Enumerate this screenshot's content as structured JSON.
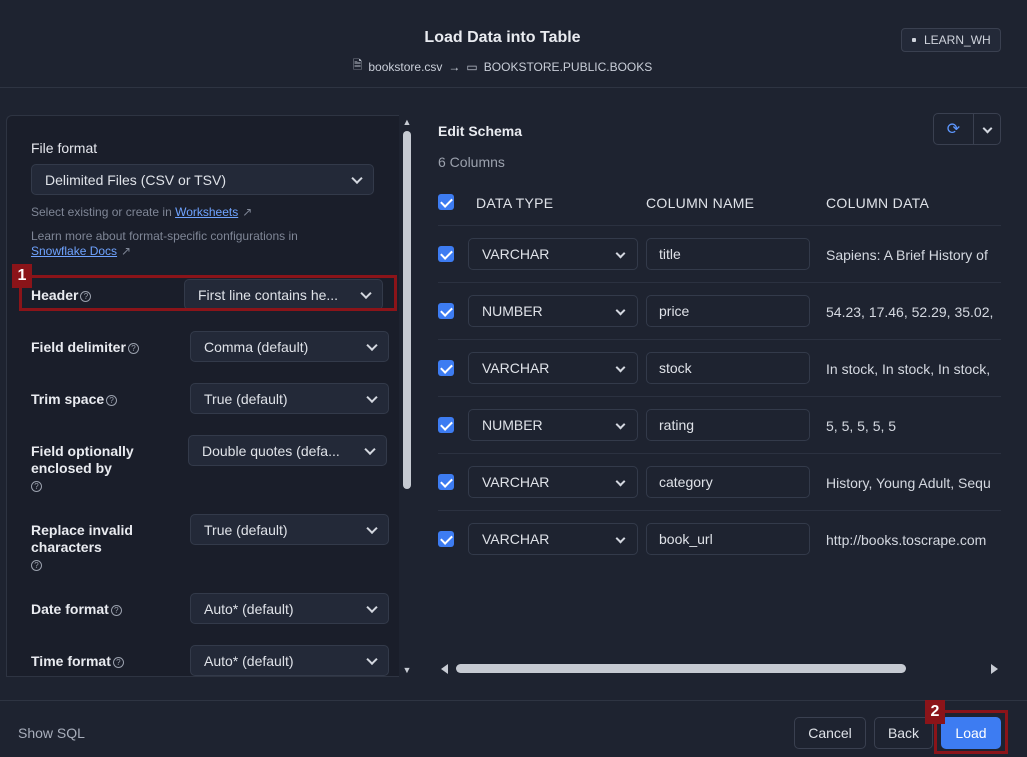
{
  "header": {
    "title": "Load Data into Table",
    "source_file": "bookstore.csv",
    "arrow": "→",
    "target_table": "BOOKSTORE.PUBLIC.BOOKS",
    "warehouse": "LEARN_WH"
  },
  "left": {
    "file_format_label": "File format",
    "file_format_value": "Delimited Files (CSV or TSV)",
    "help1_prefix": "Select existing or create in ",
    "help1_link": "Worksheets",
    "help2_prefix": "Learn more about format-specific configurations in",
    "help2_link": "Snowflake Docs",
    "fields": [
      {
        "label": "Header",
        "value": "First line contains he..."
      },
      {
        "label": "Field delimiter",
        "value": "Comma (default)"
      },
      {
        "label": "Trim space",
        "value": "True (default)"
      },
      {
        "label": "Field optionally enclosed by",
        "value": "Double quotes (defa..."
      },
      {
        "label": "Replace invalid characters",
        "value": "True (default)"
      },
      {
        "label": "Date format",
        "value": "Auto* (default)"
      },
      {
        "label": "Time format",
        "value": "Auto* (default)"
      }
    ]
  },
  "schema": {
    "title": "Edit Schema",
    "count": "6 Columns",
    "headers": {
      "type": "DATA TYPE",
      "name": "COLUMN NAME",
      "data": "COLUMN DATA"
    },
    "rows": [
      {
        "type": "VARCHAR",
        "name": "title",
        "data": "Sapiens: A Brief History of"
      },
      {
        "type": "NUMBER",
        "name": "price",
        "data": "54.23, 17.46, 52.29, 35.02,"
      },
      {
        "type": "VARCHAR",
        "name": "stock",
        "data": "In stock, In stock, In stock,"
      },
      {
        "type": "NUMBER",
        "name": "rating",
        "data": "5, 5, 5, 5, 5"
      },
      {
        "type": "VARCHAR",
        "name": "category",
        "data": "History, Young Adult, Sequ"
      },
      {
        "type": "VARCHAR",
        "name": "book_url",
        "data": "http://books.toscrape.com"
      }
    ]
  },
  "footer": {
    "show_sql": "Show SQL",
    "cancel": "Cancel",
    "back": "Back",
    "load": "Load"
  },
  "annotations": {
    "marker1": "1",
    "marker2": "2"
  },
  "colors": {
    "accent": "#3d7cf2",
    "highlight": "#8b1419",
    "background": "#1e2330"
  }
}
